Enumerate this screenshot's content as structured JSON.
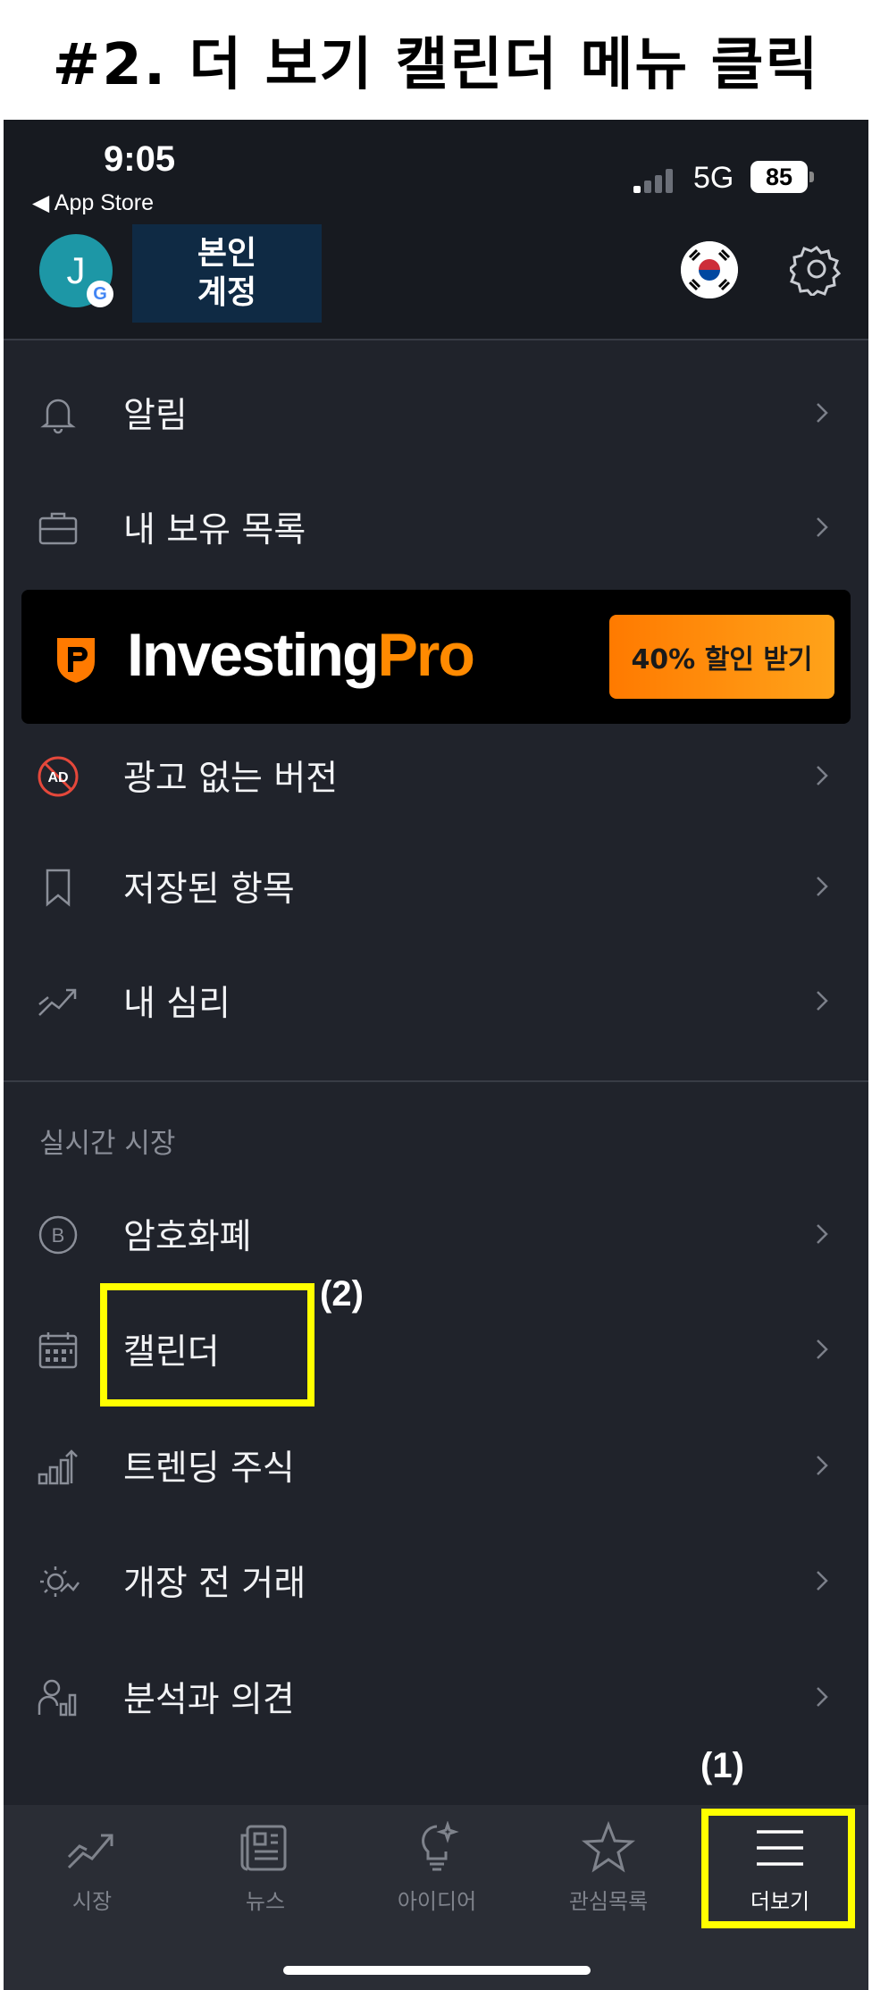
{
  "title": "#2. 더 보기 캘린더 메뉴 클릭",
  "status": {
    "time": "9:05",
    "back": "◀ App Store",
    "network": "5G",
    "battery": "85"
  },
  "header": {
    "avatar_initial": "J",
    "google_badge": "G",
    "account_label_line1": "본인",
    "account_label_line2": "계정",
    "flag_icon": "korea-flag-icon",
    "settings_icon": "gear-icon"
  },
  "menu_top": [
    {
      "label": "알림",
      "icon": "bell-icon"
    },
    {
      "label": "내 보유 목록",
      "icon": "briefcase-icon"
    }
  ],
  "promo": {
    "brand_main": "Investing",
    "brand_pro": "Pro",
    "button_label": "40% 할인 받기"
  },
  "menu_mid": [
    {
      "label": "광고 없는 버전",
      "icon": "no-ads-icon"
    },
    {
      "label": "저장된 항목",
      "icon": "bookmark-icon"
    },
    {
      "label": "내 심리",
      "icon": "sentiment-chart-icon"
    }
  ],
  "section": {
    "label": "실시간 시장"
  },
  "menu_market": [
    {
      "label": "암호화폐",
      "icon": "bitcoin-icon"
    },
    {
      "label": "캘린더",
      "icon": "calendar-icon"
    },
    {
      "label": "트렌딩 주식",
      "icon": "trending-icon"
    },
    {
      "label": "개장 전 거래",
      "icon": "sunrise-icon"
    },
    {
      "label": "분석과 의견",
      "icon": "analysis-icon"
    }
  ],
  "tabs": [
    {
      "label": "시장",
      "icon": "market-chart-icon"
    },
    {
      "label": "뉴스",
      "icon": "news-icon"
    },
    {
      "label": "아이디어",
      "icon": "lightbulb-icon"
    },
    {
      "label": "관심목록",
      "icon": "star-icon"
    },
    {
      "label": "더보기",
      "icon": "hamburger-menu-icon"
    }
  ],
  "annotations": {
    "step1": "(1)",
    "step2": "(2)",
    "highlight_color": "#ffff00"
  },
  "colors": {
    "accent": "#ff8a00",
    "background": "#20232b"
  }
}
